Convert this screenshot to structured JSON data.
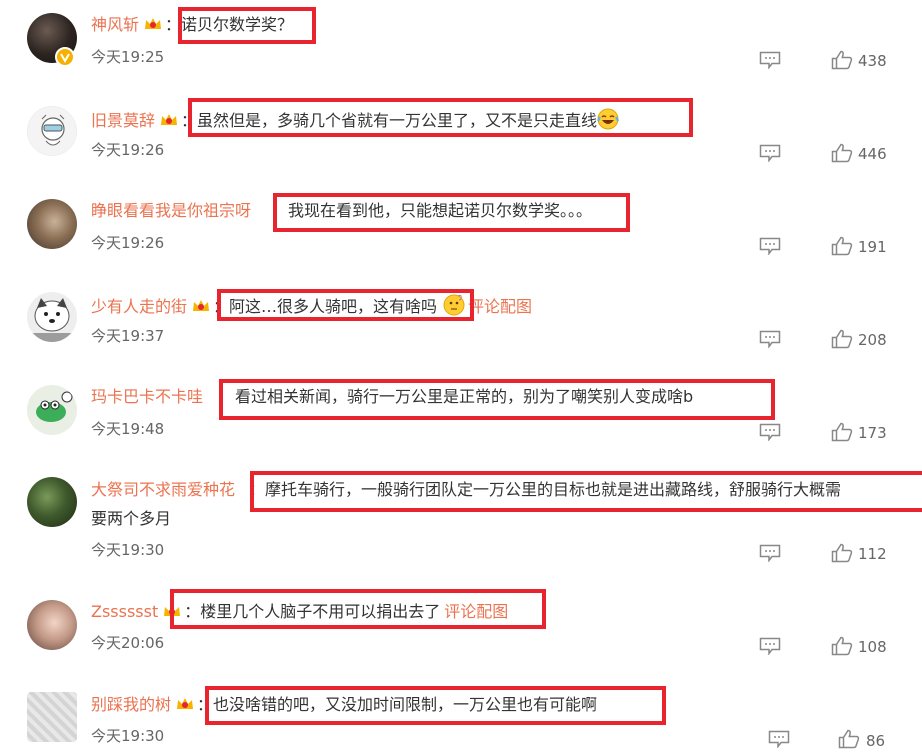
{
  "comments": [
    {
      "username": "神风斩",
      "text": "诺贝尔数学奖？",
      "link": "",
      "time": "今天19:25",
      "likes": "438"
    },
    {
      "username": "旧景莫辞",
      "text": "虽然但是，多骑几个省就有一万公里了，又不是只走直线",
      "link": "",
      "time": "今天19:26",
      "likes": "446"
    },
    {
      "username": "睁眼看看我是你祖宗呀",
      "text": "我现在看到他，只能想起诺贝尔数学奖。。。",
      "link": "",
      "time": "今天19:26",
      "likes": "191"
    },
    {
      "username": "少有人走的街",
      "text": "阿这…很多人骑吧，这有啥吗",
      "link": "评论配图",
      "time": "今天19:37",
      "likes": "208"
    },
    {
      "username": "玛卡巴卡不卡哇",
      "text": "看过相关新闻，骑行一万公里是正常的，别为了嘲笑别人变成啥b",
      "link": "",
      "time": "今天19:48",
      "likes": "173"
    },
    {
      "username": "大祭司不求雨爱种花",
      "text": "摩托车骑行，一般骑行团队定一万公里的目标也就是进出藏路线，舒服骑行大概需",
      "text2": "要两个多月",
      "link": "",
      "time": "今天19:30",
      "likes": "112"
    },
    {
      "username": "Zsssssst",
      "text": "楼里几个人脑子不用可以捐出去了",
      "link": "评论配图",
      "time": "今天20:06",
      "likes": "108"
    },
    {
      "username": "别踩我的树",
      "text": "也没啥错的吧，又没加时间限制，一万公里也有可能啊",
      "link": "",
      "time": "今天19:30",
      "likes": "86"
    }
  ],
  "colon": "：",
  "colors": {
    "username": "#eb7350",
    "highlight": "#e8242f",
    "text": "#333333",
    "meta": "#666666"
  }
}
